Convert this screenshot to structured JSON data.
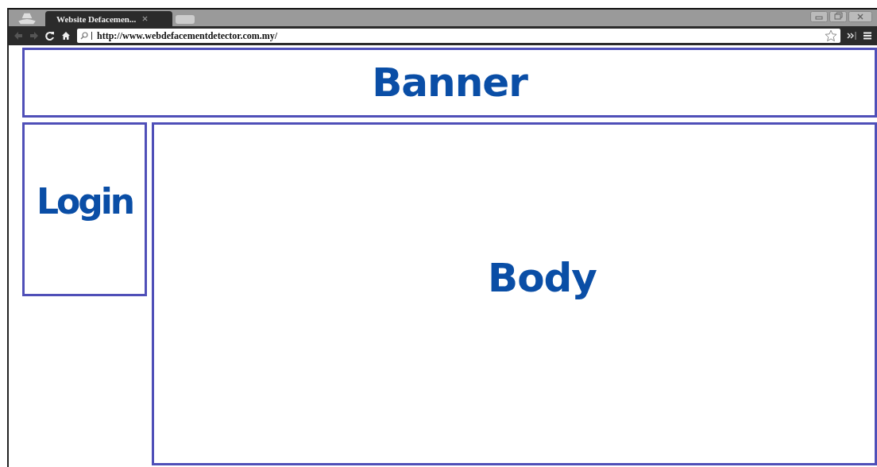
{
  "tabs": [
    {
      "title": "Website Defacemen...",
      "selected": true
    }
  ],
  "address_bar": {
    "url": "http://www.webdefacementdetector.com.my/"
  },
  "wireframe": {
    "banner": "Banner",
    "login": "Login",
    "body": "Body"
  }
}
